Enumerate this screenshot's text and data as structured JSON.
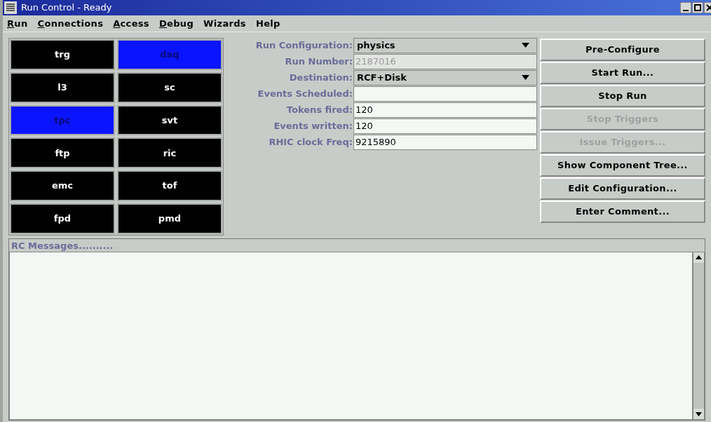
{
  "window": {
    "title": "Run Control - Ready"
  },
  "menu": [
    {
      "label": "Run",
      "mnemonic": true
    },
    {
      "label": "Connections",
      "mnemonic": true
    },
    {
      "label": "Access",
      "mnemonic": true
    },
    {
      "label": "Debug",
      "mnemonic": true
    },
    {
      "label": "Wizards",
      "mnemonic": false
    },
    {
      "label": "Help",
      "mnemonic": false
    }
  ],
  "components": [
    {
      "label": "trg",
      "active": false
    },
    {
      "label": "daq",
      "active": true
    },
    {
      "label": "l3",
      "active": false
    },
    {
      "label": "sc",
      "active": false
    },
    {
      "label": "tpc",
      "active": true
    },
    {
      "label": "svt",
      "active": false
    },
    {
      "label": "ftp",
      "active": false
    },
    {
      "label": "ric",
      "active": false
    },
    {
      "label": "emc",
      "active": false
    },
    {
      "label": "tof",
      "active": false
    },
    {
      "label": "fpd",
      "active": false
    },
    {
      "label": "pmd",
      "active": false
    }
  ],
  "fields": [
    {
      "label": "Run Configuration:",
      "kind": "dropdown",
      "value": "physics",
      "disabled": false
    },
    {
      "label": "Run Number:",
      "kind": "text",
      "value": "2187016",
      "disabled": true
    },
    {
      "label": "Destination:",
      "kind": "dropdown",
      "value": "RCF+Disk",
      "disabled": false
    },
    {
      "label": "Events Scheduled:",
      "kind": "text",
      "disabled": false
    },
    {
      "label": "Tokens fired:",
      "kind": "text",
      "value": "120",
      "disabled": false
    },
    {
      "label": "Events written:",
      "kind": "text",
      "value": "120",
      "disabled": false
    },
    {
      "label": "RHIC clock Freq:",
      "kind": "text",
      "value": "9215890",
      "disabled": false
    }
  ],
  "buttons": [
    {
      "label": "Pre-Configure",
      "disabled": false
    },
    {
      "label": "Start Run...",
      "disabled": false
    },
    {
      "label": "Stop Run",
      "disabled": false
    },
    {
      "label": "Stop Triggers",
      "disabled": true
    },
    {
      "label": "Issue Triggers...",
      "disabled": true
    },
    {
      "label": "Show Component Tree...",
      "disabled": false
    },
    {
      "label": "Edit Configuration...",
      "disabled": false
    },
    {
      "label": "Enter Comment...",
      "disabled": false
    }
  ],
  "messages": {
    "title": "RC Messages.........."
  }
}
